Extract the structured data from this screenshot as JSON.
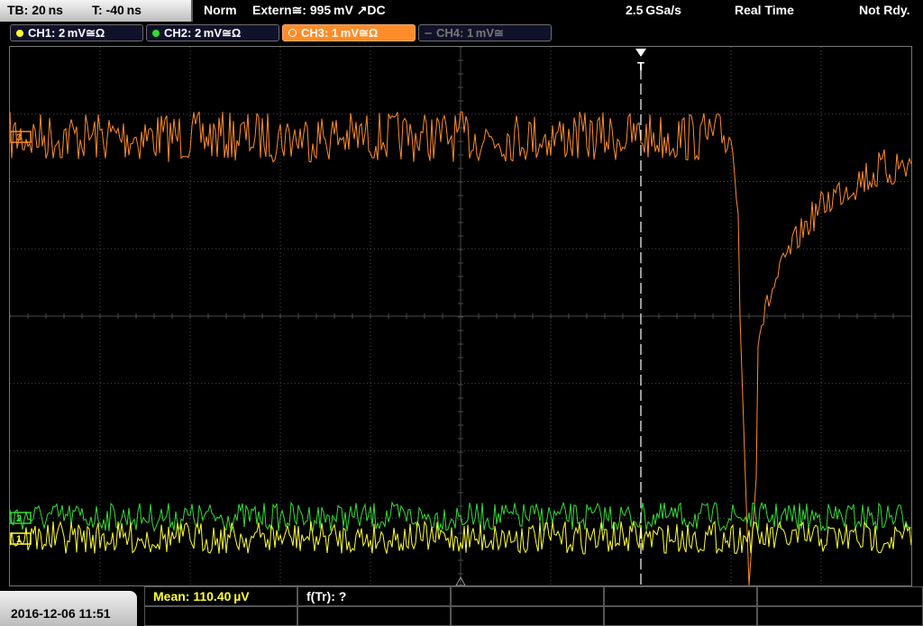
{
  "header": {
    "timebase": "TB: 20 ns",
    "trigger_time": "T: -40 ns",
    "trigger_mode": "Norm",
    "trigger_source": "Extern≅: 995 mV ↗DC",
    "sample_rate": "2.5 GSa/s",
    "acq_mode": "Real Time",
    "status": "Not Rdy."
  },
  "channels": [
    {
      "label": "CH1: 2 mV≅Ω",
      "color": "#ffff33",
      "active": true
    },
    {
      "label": "CH2: 2 mV≅Ω",
      "color": "#33dd33",
      "active": true
    },
    {
      "label": "CH3: 1 mV≅Ω",
      "color": "#ff8c2a",
      "active": true,
      "selected": true
    },
    {
      "label": "CH4: 1 mV≅",
      "color": "#777777",
      "active": false
    }
  ],
  "markers": {
    "trigger_label": "T",
    "ch3_marker": "3",
    "ch2_marker": "2",
    "ch1_marker": "1"
  },
  "footer": {
    "datetime": "2016-12-06 11:51",
    "measurement": "Mean: 110.40 µV",
    "function": "f(Tr): ?"
  },
  "colors": {
    "ch1": "#ffff33",
    "ch2": "#33dd33",
    "ch3": "#ff8c2a",
    "grid": "#4a4a4a"
  }
}
